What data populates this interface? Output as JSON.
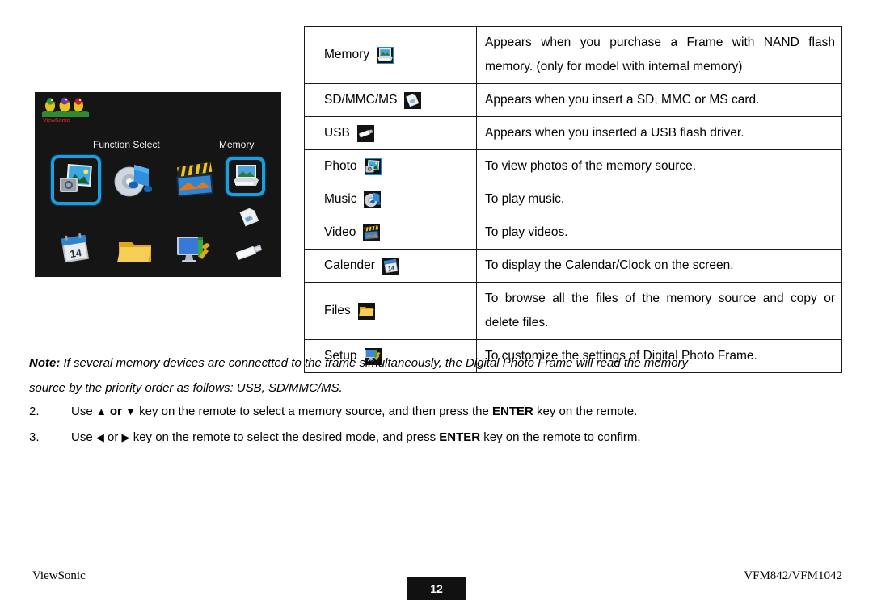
{
  "device_screen": {
    "logo_text": "ViewSonic",
    "label_function_select": "Function Select",
    "label_memory": "Memory",
    "icons": [
      {
        "name": "photo",
        "selected": true
      },
      {
        "name": "music",
        "selected": false
      },
      {
        "name": "video",
        "selected": false
      },
      {
        "name": "memory",
        "selected": true
      },
      {
        "name": "calendar",
        "selected": false
      },
      {
        "name": "files",
        "selected": false
      },
      {
        "name": "setup",
        "selected": false
      },
      {
        "name": "usb",
        "selected": false
      }
    ],
    "background_color": "#151515",
    "selection_color": "#1a9ee0"
  },
  "table": {
    "rows": [
      {
        "name": "Memory",
        "icon": "memory-icon",
        "icon_bordered": true,
        "description": "Appears when you purchase a Frame with NAND flash memory. (only for model with internal memory)",
        "justified": true
      },
      {
        "name": "SD/MMC/MS",
        "icon": "sd-card-icon",
        "icon_bordered": false,
        "description": "Appears when you insert a SD, MMC or MS card.",
        "justified": false
      },
      {
        "name": "USB",
        "icon": "usb-icon",
        "icon_bordered": false,
        "description": "Appears when you inserted a USB flash driver.",
        "justified": false
      },
      {
        "name": "Photo",
        "icon": "photo-icon",
        "icon_bordered": true,
        "description": "To view photos of the memory source.",
        "justified": false
      },
      {
        "name": "Music",
        "icon": "music-icon",
        "icon_bordered": false,
        "description": "To play music.",
        "justified": false
      },
      {
        "name": "Video",
        "icon": "video-icon",
        "icon_bordered": false,
        "description": "To play videos.",
        "justified": false
      },
      {
        "name": "Calender",
        "icon": "calendar-icon",
        "icon_bordered": false,
        "description": "To display the Calendar/Clock on the screen.",
        "justified": false
      },
      {
        "name": "Files",
        "icon": "files-icon",
        "icon_bordered": false,
        "description": "To browse all the files of the memory source and copy or delete files.",
        "justified": true
      },
      {
        "name": "Setup",
        "icon": "setup-icon",
        "icon_bordered": false,
        "description": "To customize the settings of Digital Photo Frame.",
        "justified": false
      }
    ]
  },
  "note": {
    "label": "Note:",
    "line1": " If several memory devices are connectted to the frame simultaneously, the Digital Photo Frame will read the memory",
    "line2": "source by the priority order as follows: USB, SD/MMC/MS."
  },
  "steps": [
    {
      "number": "2.",
      "pre": "Use ",
      "key_a": "▲",
      "mid": " or ",
      "mid_bold": true,
      "key_b": "▼",
      "post_1": " key on the remote to select a memory source, and then press the ",
      "emphasis": "ENTER",
      "post_2": " key on the remote."
    },
    {
      "number": "3.",
      "pre": "Use ",
      "key_a": "◀",
      "mid": " or ",
      "mid_bold": false,
      "key_b": "▶",
      "post_1": " key on the remote to select the desired mode, and press ",
      "emphasis": "ENTER",
      "post_2": " key on the remote to confirm."
    }
  ],
  "footer": {
    "brand": "ViewSonic",
    "page_number": "12",
    "model": "VFM842/VFM1042"
  }
}
